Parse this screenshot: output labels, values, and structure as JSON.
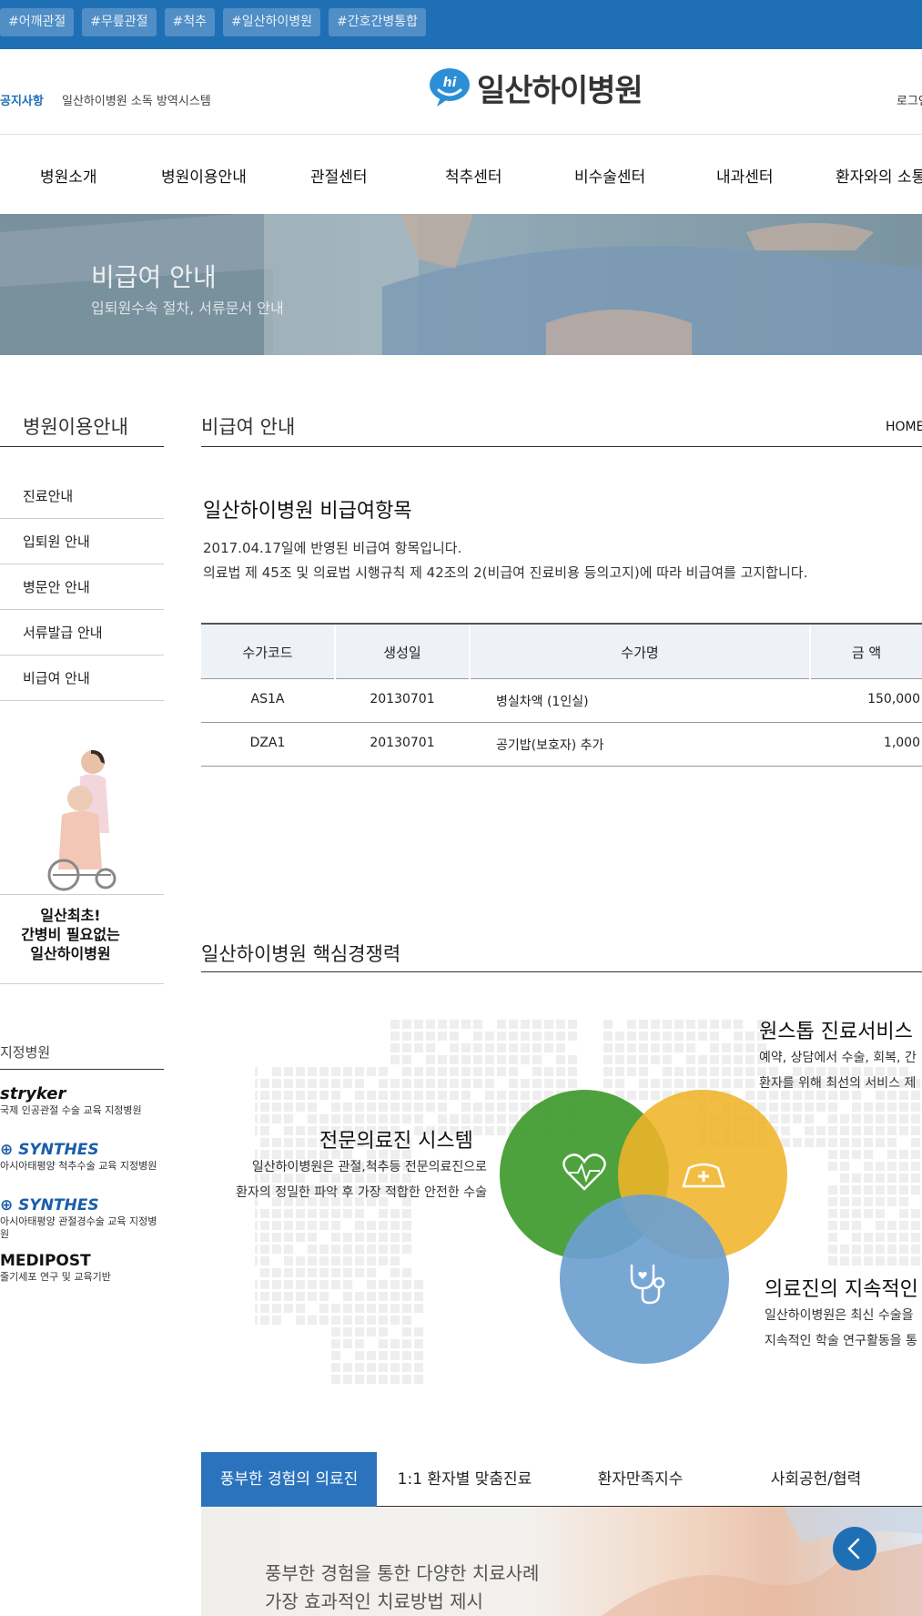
{
  "topbar": {
    "tags": [
      "#어깨관절",
      "#무릎관절",
      "#척추",
      "#일산하이병원",
      "#간호간병통합"
    ]
  },
  "header": {
    "notice_label": "공지사항",
    "notice_text": "일산하이병원 소독 방역시스템",
    "logo_mark": "hi",
    "logo_text": "일산하이병원",
    "login": "로그인"
  },
  "gnb": {
    "items": [
      "병원소개",
      "병원이용안내",
      "관절센터",
      "척추센터",
      "비수술센터",
      "내과센터",
      "환자와의 소통"
    ]
  },
  "hero": {
    "title": "비급여 안내",
    "subtitle": "입퇴원수속 절차, 서류문서 안내"
  },
  "sidebar": {
    "title": "병원이용안내",
    "items": [
      "진료안내",
      "입퇴원 안내",
      "병문안 안내",
      "서류발급 안내",
      "비급여 안내"
    ],
    "promo": {
      "line1": "일산최초!",
      "line2": "간병비 필요없는",
      "line3": "일산하이병원"
    },
    "designated": {
      "title": "지정병원",
      "partners": [
        {
          "logo": "stryker",
          "desc": "국제 인공관절 수술 교육 지정병원"
        },
        {
          "logo": "SYNTHES",
          "desc": "아시아태평양 척추수술 교육 지정병원"
        },
        {
          "logo": "SYNTHES",
          "desc": "아시아태평양 관절경수술 교육 지정병원"
        },
        {
          "logo": "MEDIPOST",
          "desc": "줄기세포 연구 및 교육기반"
        }
      ]
    }
  },
  "main": {
    "page_title": "비급여 안내",
    "breadcrumb": "HOME",
    "section_title": "일산하이병원 비급여항목",
    "date_text": "2017.04.17일에 반영된 비급여 항목입니다.",
    "law_text": "의료법 제 45조 및 의료법 시행규칙 제 42조의 2(비급여 진료비용 등의고지)에 따라 비급여를 고지합니다.",
    "table": {
      "headers": [
        "수가코드",
        "생성일",
        "수가명",
        "금 액"
      ],
      "rows": [
        [
          "AS1A",
          "20130701",
          "병실차액 (1인실)",
          "150,000"
        ],
        [
          "DZA1",
          "20130701",
          "공기밥(보호자) 추가",
          "1,000"
        ]
      ]
    },
    "competency": {
      "title": "일산하이병원 핵심경쟁력",
      "left_title": "전문의료진 시스템",
      "left_desc1": "일산하이병원은 관절,척추등 전문의료진으로",
      "left_desc2": "환자의 정밀한 파악 후 가장 적합한 안전한 수술",
      "right_top_title": "원스톱 진료서비스",
      "right_top_desc1": "예약, 상담에서 수술, 회복, 간",
      "right_top_desc2": "환자를 위해 최선의 서비스 제",
      "right_bottom_title": "의료진의 지속적인",
      "right_bottom_desc1": "일산하이병원은 최신 수술을",
      "right_bottom_desc2": "지속적인 학술 연구활동을 통",
      "colors": {
        "green": "#3f9a2c",
        "yellow": "#f0b429",
        "blue": "#6c9fd0"
      }
    },
    "tabs": [
      "풍부한 경험의 의료진",
      "1:1 환자별 맞춤진료",
      "환자만족지수",
      "사회공헌/협력"
    ],
    "panel_line1": "풍부한 경험을 통한 다양한 치료사례",
    "panel_line2": "가장 효과적인 치료방법 제시"
  }
}
